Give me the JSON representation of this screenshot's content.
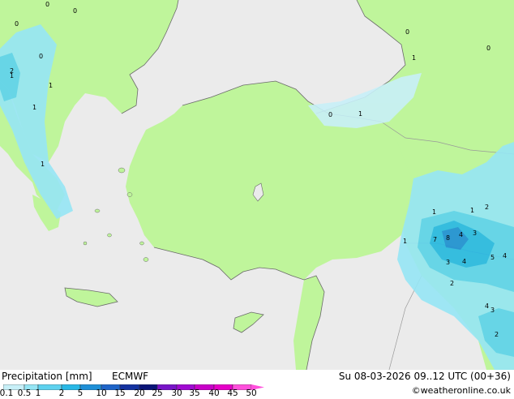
{
  "title": "Precipitation [mm]",
  "model": "ECMWF",
  "valid_time": "Su 08-03-2026 09..12 UTC (00+36)",
  "credit": "©weatheronline.co.uk",
  "legend": {
    "labels": [
      "0.1",
      "0.5",
      "1",
      "2",
      "5",
      "10",
      "15",
      "20",
      "25",
      "30",
      "35",
      "40",
      "45",
      "50"
    ],
    "colors": [
      "#ffffff",
      "#c8f0f8",
      "#96e6f5",
      "#5ed2ef",
      "#28b8e6",
      "#1e8fd7",
      "#1e64c8",
      "#1432a0",
      "#0a1478",
      "#7814c8",
      "#a00ad2",
      "#c800c8",
      "#e600c8",
      "#ff50dc"
    ]
  },
  "map": {
    "land_color": "#bff59b",
    "sea_color": "#ebebeb",
    "value_labels": [
      "0",
      "0",
      "0",
      "0",
      "0",
      "0",
      "0",
      "1",
      "1",
      "1",
      "1",
      "1",
      "1",
      "1",
      "1",
      "1",
      "2",
      "2",
      "2",
      "2",
      "3",
      "3",
      "3",
      "4",
      "4",
      "4",
      "4",
      "5",
      "7",
      "8"
    ]
  }
}
